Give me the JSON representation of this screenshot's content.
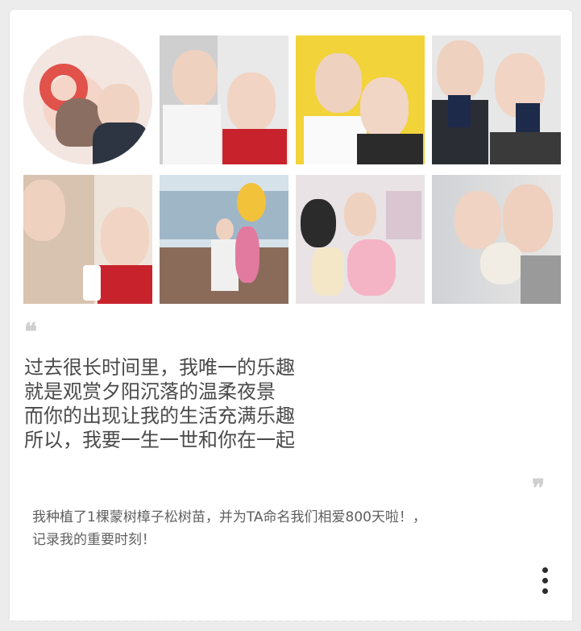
{
  "post": {
    "quote_open_glyph": "❝",
    "quote_close_glyph": "❞",
    "poem_lines": [
      "过去很长时间里，我唯一的乐趣",
      "就是观赏夕阳沉落的温柔夜景",
      "而你的出现让我的生活充满乐趣",
      "所以，我要一生一世和你在一起"
    ],
    "caption_line1": "我种植了1棵蒙树樟子松树苗，并为TA命名我们相爱800天啦！，",
    "caption_line2": "记录我的重要时刻！",
    "more_icon": "more-vertical-icon"
  },
  "photos": [
    {
      "name": "photo-1",
      "shape": "circle",
      "bg": "#f3e6e0",
      "accent": "#e0524a"
    },
    {
      "name": "photo-2",
      "shape": "square",
      "bg": "#d9d9d9",
      "accent": "#c8232c"
    },
    {
      "name": "photo-3",
      "shape": "square",
      "bg": "#f2d33a",
      "accent": "#ffffff"
    },
    {
      "name": "photo-4",
      "shape": "square",
      "bg": "#e7e7e7",
      "accent": "#1e2a4a"
    },
    {
      "name": "photo-5",
      "shape": "square",
      "bg": "#d8c3b0",
      "accent": "#c8232c"
    },
    {
      "name": "photo-6",
      "shape": "square",
      "bg": "#9fb6c7",
      "accent": "#f2c23a"
    },
    {
      "name": "photo-7",
      "shape": "square",
      "bg": "#e9e3e6",
      "accent": "#f4b4c5"
    },
    {
      "name": "photo-8",
      "shape": "square",
      "bg": "#cfd2d6",
      "accent": "#f1ede4"
    }
  ]
}
